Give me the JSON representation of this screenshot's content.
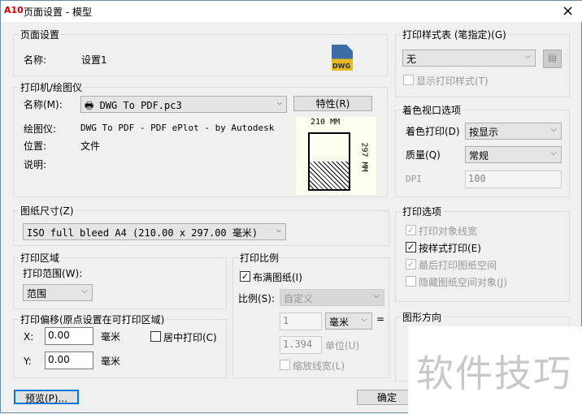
{
  "window": {
    "title": "页面设置 - 模型",
    "app_icon": "A10",
    "close": "×"
  },
  "page_setup": {
    "label": "页面设置",
    "name_label": "名称:",
    "name_value": "设置1",
    "icon_text": "DWG"
  },
  "printer": {
    "label": "打印机/绘图仪",
    "name_label": "名称(M):",
    "name_value": "DWG To PDF.pc3",
    "properties_button": "特性(R)",
    "plotter_label": "绘图仪:",
    "plotter_value": "DWG To PDF - PDF ePlot - by Autodesk",
    "location_label": "位置:",
    "location_value": "文件",
    "description_label": "说明:",
    "preview_width": "210 MM",
    "preview_height": "297 MM"
  },
  "paper_size": {
    "label": "图纸尺寸(Z)",
    "value": "ISO full bleed A4 (210.00 x 297.00 毫米)"
  },
  "plot_area": {
    "label": "打印区域",
    "range_label": "打印范围(W):",
    "range_value": "范围"
  },
  "plot_offset": {
    "label": "打印偏移(原点设置在可打印区域)",
    "x_label": "X:",
    "x_value": "0.00",
    "y_label": "Y:",
    "y_value": "0.00",
    "unit": "毫米",
    "center_label": "居中打印(C)",
    "center_checked": false
  },
  "plot_scale": {
    "label": "打印比例",
    "fit_label": "布满图纸(I)",
    "fit_checked": true,
    "scale_label": "比例(S):",
    "scale_value": "自定义",
    "value1": "1",
    "unit_value": "毫米",
    "equals": "=",
    "value2": "1.394",
    "unit2": "单位(U)",
    "lineweights_label": "缩放线宽(L)"
  },
  "plot_style": {
    "label": "打印样式表 (笔指定)(G)",
    "value": "无",
    "display_label": "显示打印样式(T)"
  },
  "shaded": {
    "label": "着色视口选项",
    "shade_label": "着色打印(D)",
    "shade_value": "按显示",
    "quality_label": "质量(Q)",
    "quality_value": "常规",
    "dpi_label": "DPI",
    "dpi_value": "100"
  },
  "options": {
    "label": "打印选项",
    "items": [
      {
        "label": "打印对象线宽",
        "checked": true,
        "disabled": true
      },
      {
        "label": "按样式打印(E)",
        "checked": true,
        "disabled": false
      },
      {
        "label": "最后打印图纸空间",
        "checked": true,
        "disabled": true
      },
      {
        "label": "隐藏图纸空间对象(J)",
        "checked": false,
        "disabled": true
      }
    ]
  },
  "orientation": {
    "label": "图形方向"
  },
  "buttons": {
    "preview": "预览(P)...",
    "ok": "确定"
  },
  "watermark": "软件技巧"
}
